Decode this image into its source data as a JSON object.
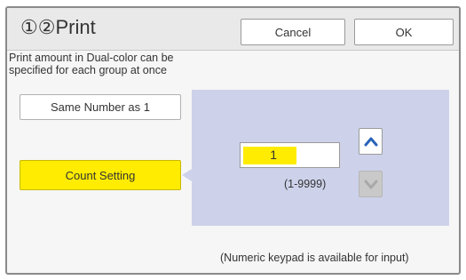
{
  "header": {
    "title": "①②Print",
    "cancel_label": "Cancel",
    "ok_label": "OK"
  },
  "description": "Print amount in Dual-color can be\nspecified for each group at once",
  "options": {
    "same_number_label": "Same Number as 1",
    "count_setting_label": "Count Setting"
  },
  "count": {
    "value": "1",
    "range": "(1-9999)"
  },
  "icons": {
    "up": "chevron-up-icon",
    "down": "chevron-down-icon"
  },
  "note": "(Numeric keypad is available for input)",
  "colors": {
    "accent_yellow": "#ffec00",
    "panel_blue": "#cdd2ea",
    "arrow_blue": "#2a63b8"
  }
}
